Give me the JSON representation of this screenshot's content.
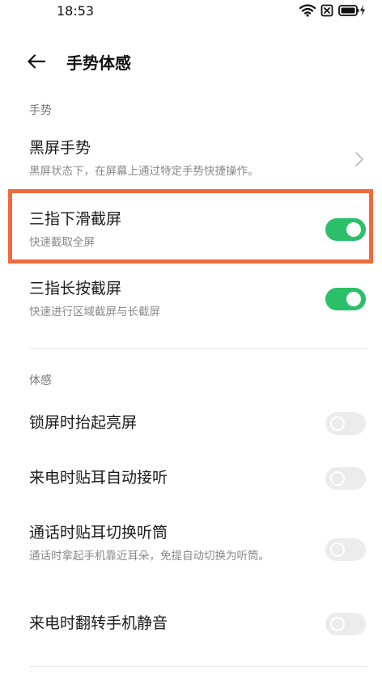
{
  "status_bar": {
    "time": "18:53",
    "icons": [
      "wifi-icon",
      "sim-blocked-icon",
      "battery-charging-icon"
    ]
  },
  "header": {
    "back_icon": "back-arrow-icon",
    "title": "手势体感"
  },
  "sections": {
    "gesture": {
      "header": "手势",
      "items": [
        {
          "title": "黑屏手势",
          "subtitle": "黑屏状态下，在屏幕上通过特定手势快捷操作。",
          "control": "chevron"
        },
        {
          "title": "三指下滑截屏",
          "subtitle": "快速截取全屏",
          "control": "toggle",
          "enabled": true,
          "highlighted": true
        },
        {
          "title": "三指长按截屏",
          "subtitle": "快速进行区域截屏与长截屏",
          "control": "toggle",
          "enabled": true
        }
      ]
    },
    "motion": {
      "header": "体感",
      "items": [
        {
          "title": "锁屏时抬起亮屏",
          "control": "toggle",
          "enabled": false
        },
        {
          "title": "来电时贴耳自动接听",
          "control": "toggle",
          "enabled": false
        },
        {
          "title": "通话时贴耳切换听筒",
          "subtitle": "通话时拿起手机靠近耳朵，免提自动切换为听筒。",
          "control": "toggle",
          "enabled": false
        },
        {
          "title": "来电时翻转手机静音",
          "control": "toggle",
          "enabled": false
        }
      ]
    }
  },
  "colors": {
    "toggle_on": "#2bbf6a",
    "toggle_off": "#ececec",
    "highlight": "#ef6a3c"
  }
}
